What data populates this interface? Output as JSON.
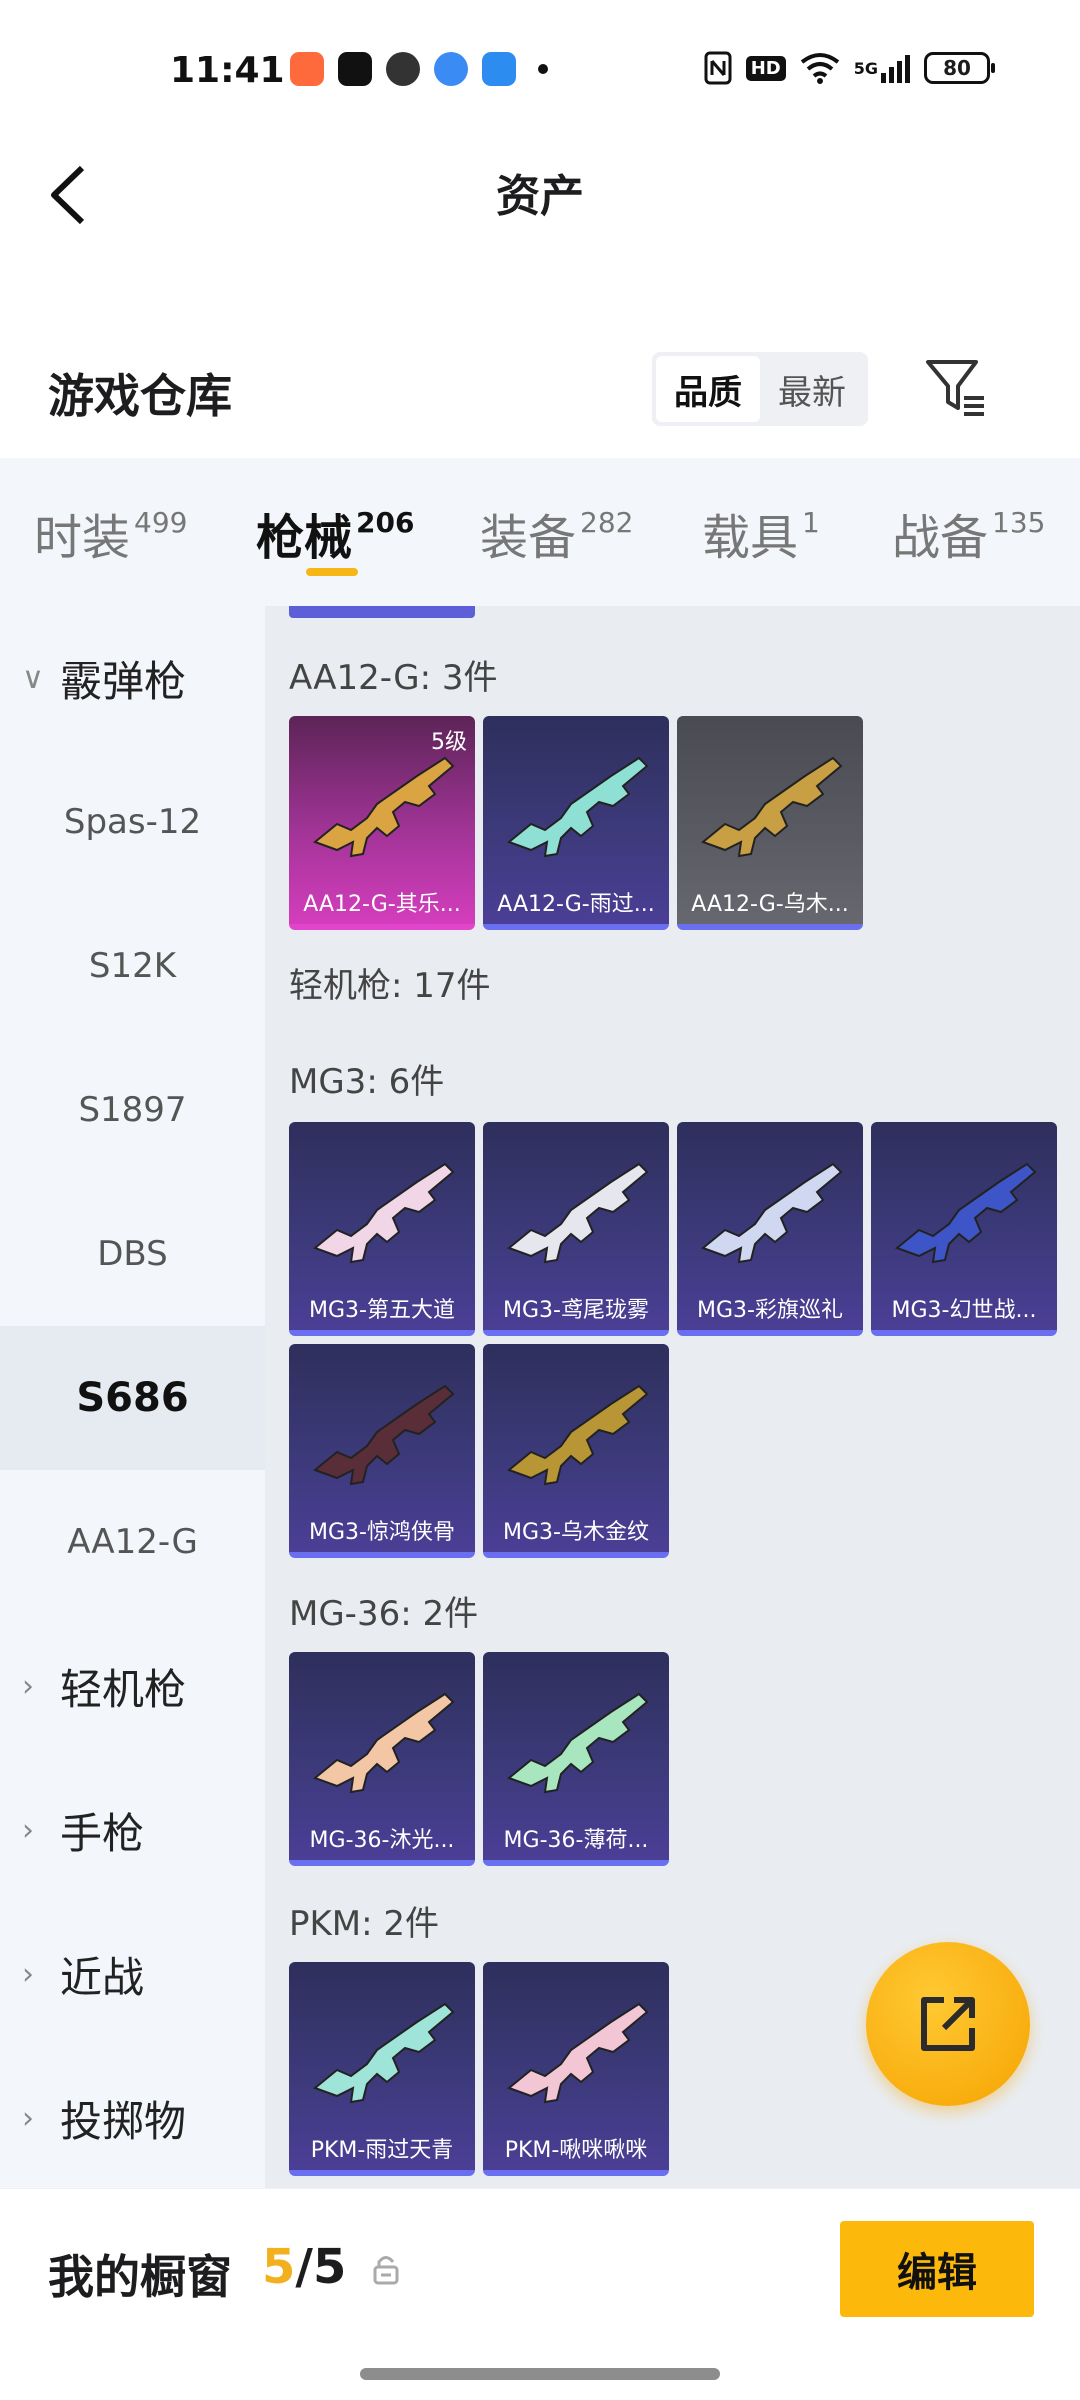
{
  "status_bar": {
    "time": "11:41",
    "signal_label": "5G",
    "hd_label": "HD",
    "battery": "80",
    "app_icons": [
      "game-app-icon",
      "tiktok-icon",
      "wechat-icon",
      "blue-app-icon",
      "calendar-app-icon"
    ]
  },
  "header": {
    "title": "资产"
  },
  "warehouse": {
    "title": "游戏仓库",
    "sort_options": [
      "品质",
      "最新"
    ],
    "active_sort": "品质"
  },
  "tabs": [
    {
      "label": "时装",
      "count": "499"
    },
    {
      "label": "枪械",
      "count": "206"
    },
    {
      "label": "装备",
      "count": "282"
    },
    {
      "label": "载具",
      "count": "1"
    },
    {
      "label": "战备",
      "count": "135"
    }
  ],
  "active_tab": "枪械",
  "sidebar": {
    "items": [
      {
        "label": "霰弹枪",
        "type": "group",
        "chevron": "expanded"
      },
      {
        "label": "Spas-12",
        "type": "child"
      },
      {
        "label": "S12K",
        "type": "child"
      },
      {
        "label": "S1897",
        "type": "child"
      },
      {
        "label": "DBS",
        "type": "child"
      },
      {
        "label": "S686",
        "type": "child",
        "selected": true
      },
      {
        "label": "AA12-G",
        "type": "child"
      },
      {
        "label": "轻机枪",
        "type": "group",
        "chevron": "collapsed"
      },
      {
        "label": "手枪",
        "type": "group",
        "chevron": "collapsed"
      },
      {
        "label": "近战",
        "type": "group",
        "chevron": "collapsed"
      },
      {
        "label": "投掷物",
        "type": "group",
        "chevron": "collapsed"
      }
    ]
  },
  "content": {
    "sections": [
      {
        "title": "AA12-G: 3件",
        "items": [
          {
            "label": "AA12-G-其乐...",
            "rarity": "pink",
            "badge": "5级",
            "gun_color": "#d9a441"
          },
          {
            "label": "AA12-G-雨过...",
            "rarity": "purple",
            "gun_color": "#8fe0d4"
          },
          {
            "label": "AA12-G-乌木...",
            "rarity": "gray",
            "gun_color": "#c8a043"
          }
        ]
      },
      {
        "title": "轻机枪: 17件",
        "items": []
      },
      {
        "title": "MG3: 6件",
        "items": [
          {
            "label": "MG3-第五大道",
            "rarity": "purple",
            "gun_color": "#f0d6e6"
          },
          {
            "label": "MG3-鸢尾珑雾",
            "rarity": "purple",
            "gun_color": "#e6e6ee"
          },
          {
            "label": "MG3-彩旗巡礼",
            "rarity": "purple",
            "gun_color": "#cfd8f0"
          },
          {
            "label": "MG3-幻世战...",
            "rarity": "purple",
            "gun_color": "#3e55c8"
          },
          {
            "label": "MG3-惊鸿侠骨",
            "rarity": "purple",
            "gun_color": "#5a2e38"
          },
          {
            "label": "MG3-乌木金纹",
            "rarity": "purple",
            "gun_color": "#b89636"
          }
        ]
      },
      {
        "title": "MG-36: 2件",
        "items": [
          {
            "label": "MG-36-沐光...",
            "rarity": "purple",
            "gun_color": "#f3c7a6"
          },
          {
            "label": "MG-36-薄荷...",
            "rarity": "purple",
            "gun_color": "#a8e6c0"
          }
        ]
      },
      {
        "title": "PKM: 2件",
        "items": [
          {
            "label": "PKM-雨过天青",
            "rarity": "purple",
            "gun_color": "#9ee4d8"
          },
          {
            "label": "PKM-啾咪啾咪",
            "rarity": "purple",
            "gun_color": "#f2c6d4"
          }
        ]
      }
    ]
  },
  "fab": {
    "icon": "share-external-icon"
  },
  "showcase": {
    "title": "我的橱窗",
    "current": "5",
    "separator": "/",
    "total": "5",
    "edit_label": "编辑"
  },
  "colors": {
    "accent": "#fcb90c",
    "tab_underline": "#f6b716",
    "purple_rarity": "#6a6ff0",
    "pink_rarity": "#e045cc"
  }
}
